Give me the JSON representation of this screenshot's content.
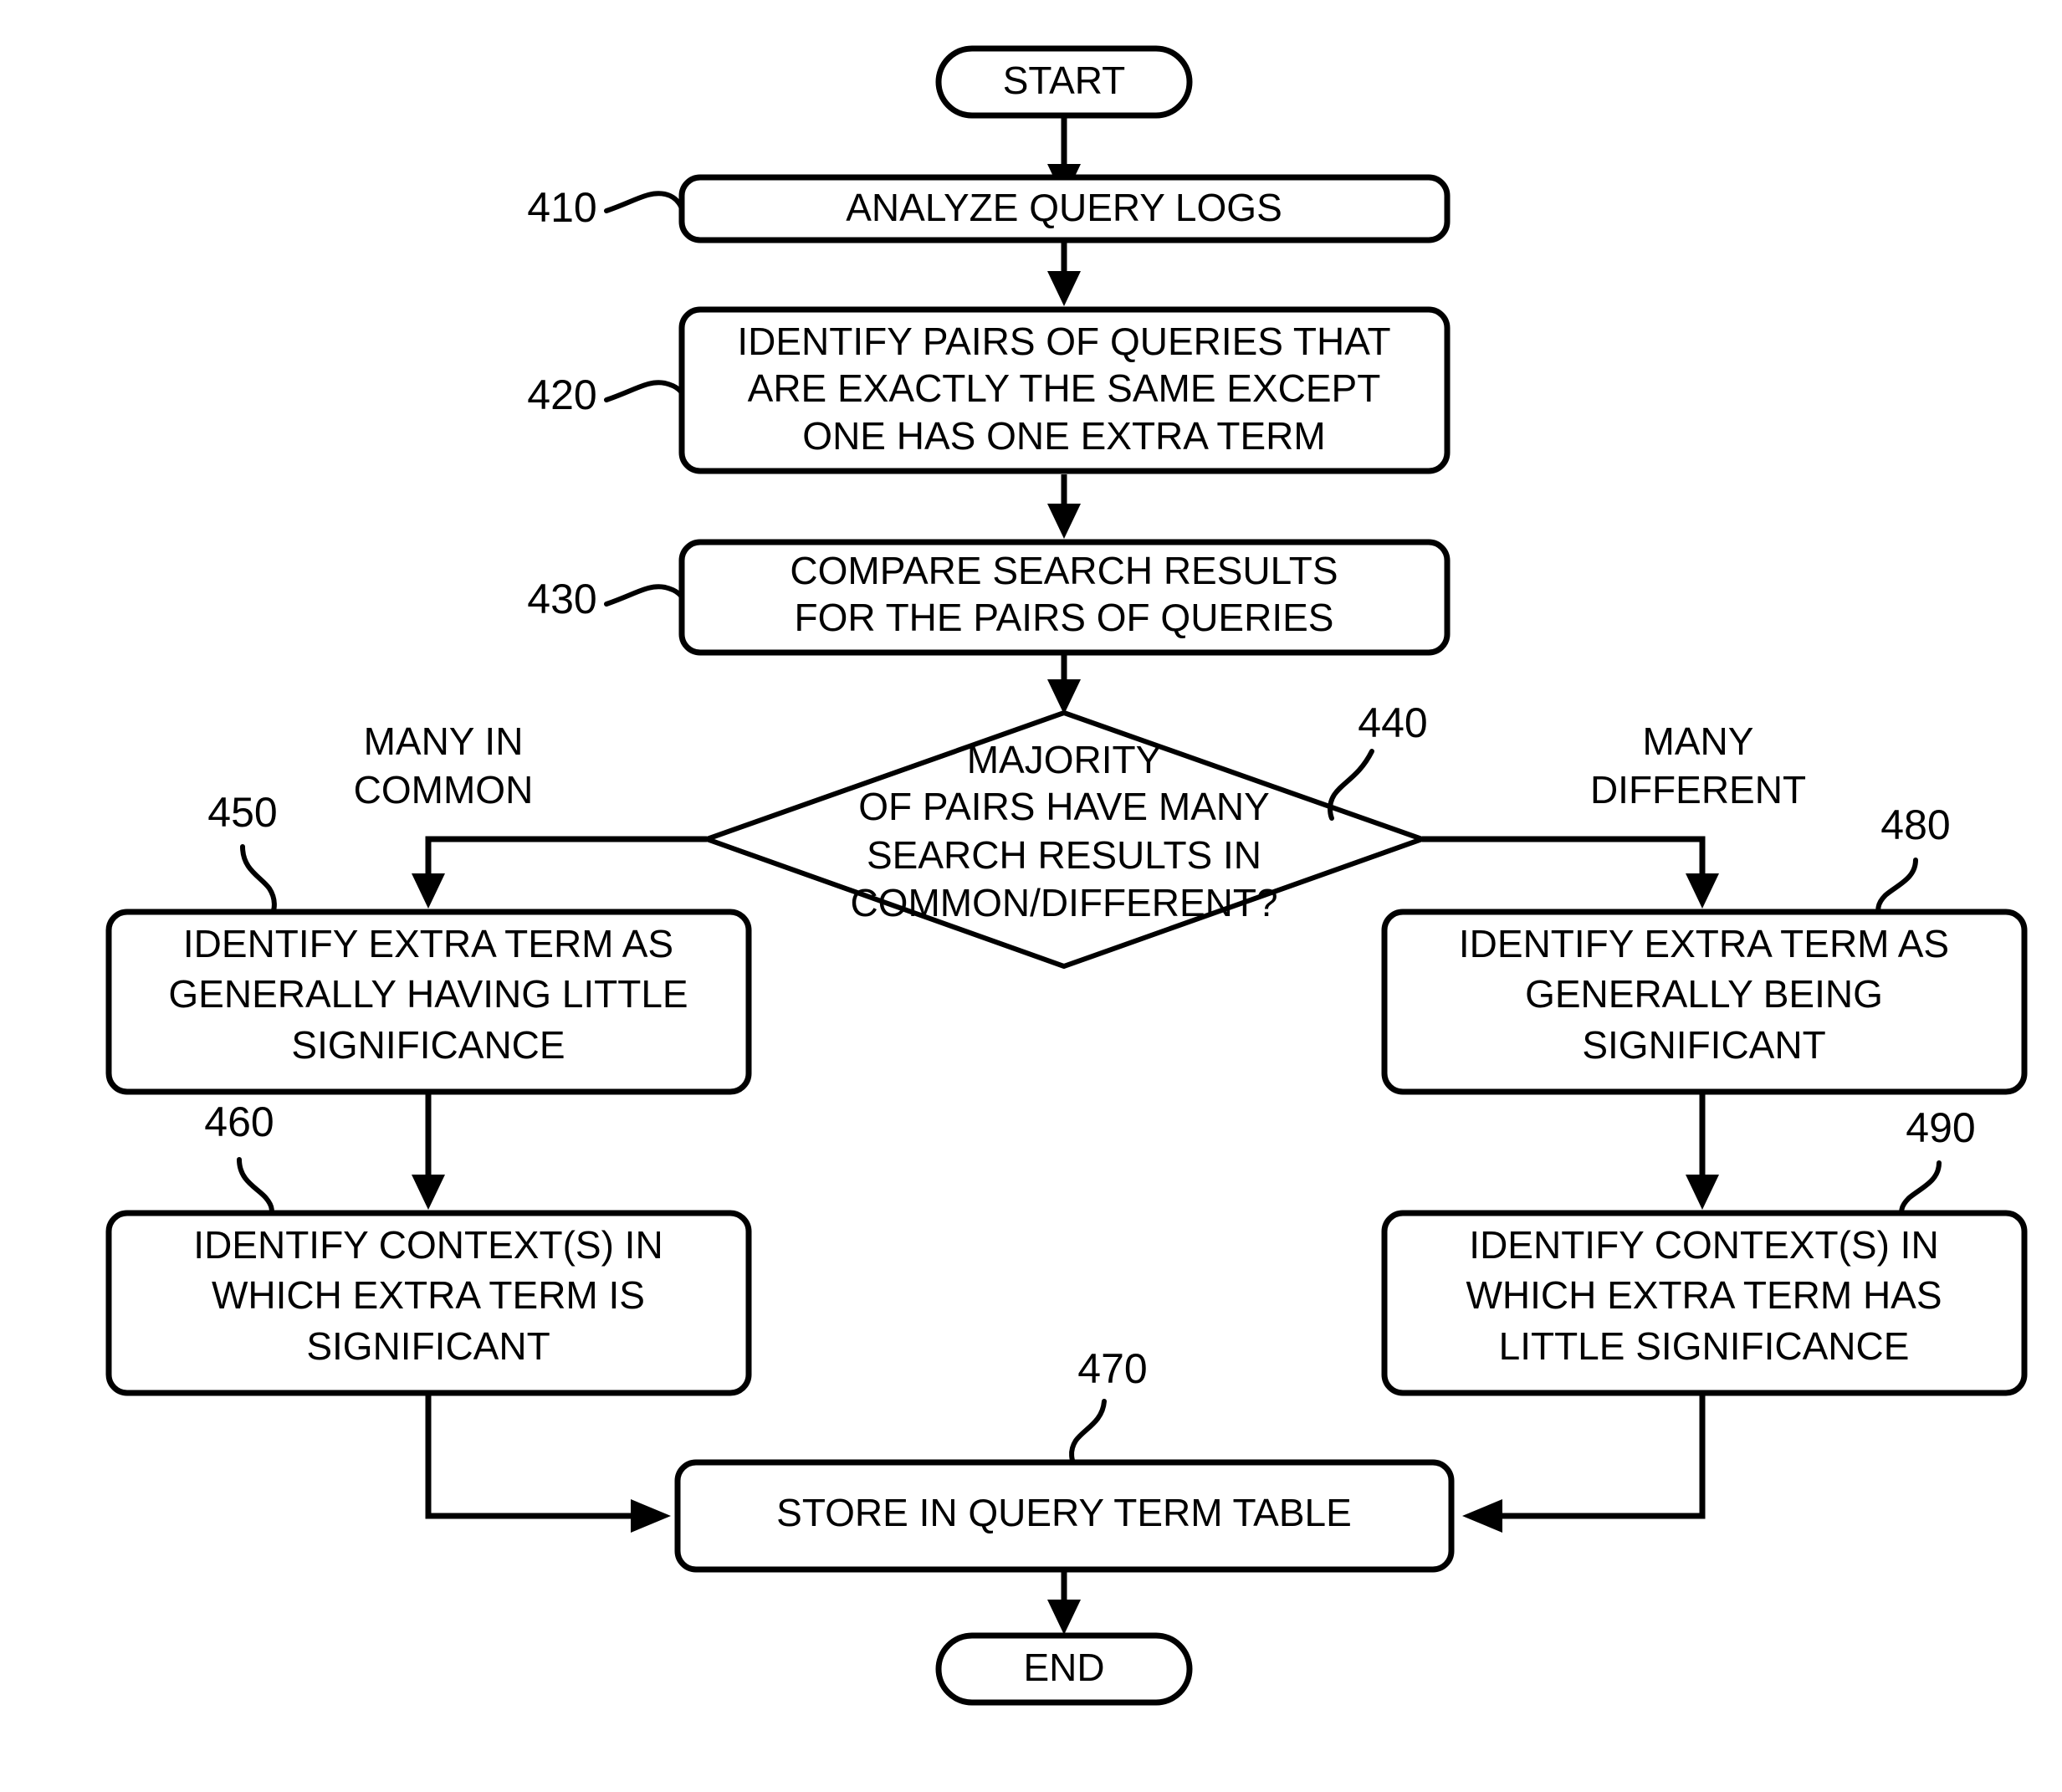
{
  "diagram": {
    "title": "Query term significance determination flowchart",
    "type": "flowchart",
    "stroke_color": "#000000",
    "fill_color": "#ffffff",
    "background_color": "#ffffff"
  },
  "terminals": [
    {
      "id": "start",
      "label": "START"
    },
    {
      "id": "end",
      "label": "END"
    }
  ],
  "processes": [
    {
      "id": "p410",
      "ref": "410",
      "lines": [
        "ANALYZE QUERY LOGS"
      ]
    },
    {
      "id": "p420",
      "ref": "420",
      "lines": [
        "IDENTIFY PAIRS OF QUERIES THAT",
        "ARE EXACTLY THE SAME EXCEPT",
        "ONE HAS ONE EXTRA TERM"
      ]
    },
    {
      "id": "p430",
      "ref": "430",
      "lines": [
        "COMPARE SEARCH RESULTS",
        "FOR THE PAIRS OF QUERIES"
      ]
    },
    {
      "id": "p450",
      "ref": "450",
      "lines": [
        "IDENTIFY EXTRA TERM AS",
        "GENERALLY HAVING LITTLE",
        "SIGNIFICANCE"
      ]
    },
    {
      "id": "p460",
      "ref": "460",
      "lines": [
        "IDENTIFY CONTEXT(S) IN",
        "WHICH EXTRA TERM IS",
        "SIGNIFICANT"
      ]
    },
    {
      "id": "p480",
      "ref": "480",
      "lines": [
        "IDENTIFY EXTRA TERM AS",
        "GENERALLY BEING",
        "SIGNIFICANT"
      ]
    },
    {
      "id": "p490",
      "ref": "490",
      "lines": [
        "IDENTIFY CONTEXT(S) IN",
        "WHICH EXTRA TERM HAS",
        "LITTLE SIGNIFICANCE"
      ]
    },
    {
      "id": "p470",
      "ref": "470",
      "lines": [
        "STORE IN QUERY TERM TABLE"
      ]
    }
  ],
  "decision": {
    "id": "d440",
    "ref": "440",
    "lines": [
      "MAJORITY",
      "OF PAIRS HAVE MANY",
      "SEARCH RESULTS IN",
      "COMMON/DIFFERENT?"
    ]
  },
  "branch_labels": [
    {
      "id": "left",
      "lines": [
        "MANY IN",
        "COMMON"
      ]
    },
    {
      "id": "right",
      "lines": [
        "MANY",
        "DIFFERENT"
      ]
    }
  ],
  "reference_numerals": {
    "r410": "410",
    "r420": "420",
    "r430": "430",
    "r440": "440",
    "r450": "450",
    "r460": "460",
    "r470": "470",
    "r480": "480",
    "r490": "490"
  }
}
